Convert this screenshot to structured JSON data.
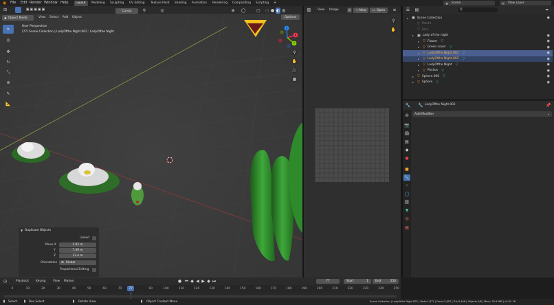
{
  "menu": {
    "items": [
      "File",
      "Edit",
      "Render",
      "Window",
      "Help"
    ],
    "workspaces": [
      "Layout",
      "Modeling",
      "Sculpting",
      "UV Editing",
      "Texture Paint",
      "Shading",
      "Animation",
      "Rendering",
      "Compositing",
      "Scripting"
    ],
    "active_workspace": "Layout",
    "add_tab": "+",
    "scene_label": "Scene",
    "view_layer_label": "View Layer"
  },
  "viewport": {
    "mode": "Object Mode",
    "menus": [
      "View",
      "Select",
      "Add",
      "Object"
    ],
    "transform_orientation": "Cursor",
    "options_label": "Options",
    "perspective": "User Perspective",
    "collection_info": "(77) Scene Collection | LadyOfthe Night.002 : LadyOfthe Night",
    "gizmo": {
      "x": "X",
      "y": "Y",
      "z": "Z"
    }
  },
  "operator_panel": {
    "title": "Duplicate Objects",
    "linked_label": "Linked",
    "move_x_label": "Move X",
    "move_x": "5.92 m",
    "y_label": "Y",
    "y": "7.49 m",
    "z_label": "Z",
    "z": "13.4 m",
    "orientation_label": "Orientation",
    "orientation": "Global",
    "proportional_label": "Proportional Editing"
  },
  "image_editor": {
    "menus": [
      "View",
      "Image"
    ],
    "new_label": "+ New",
    "open_label": "Open"
  },
  "outliner": {
    "search_placeholder": "",
    "items": [
      {
        "label": "Scene Collection",
        "indent": 0,
        "kind": "collection",
        "muted": false,
        "selected": false
      },
      {
        "label": "Point1",
        "indent": 1,
        "kind": "muted",
        "muted": true,
        "selected": false
      },
      {
        "label": "Fern",
        "indent": 1,
        "kind": "muted",
        "muted": true,
        "selected": false
      },
      {
        "label": "Lady of the night",
        "indent": 1,
        "kind": "collection",
        "muted": false,
        "selected": false
      },
      {
        "label": "Flower",
        "indent": 2,
        "kind": "object",
        "muted": false,
        "selected": false
      },
      {
        "label": "Green cover",
        "indent": 2,
        "kind": "object",
        "muted": false,
        "selected": false
      },
      {
        "label": "LadyOfthe Night.001",
        "indent": 2,
        "kind": "object",
        "muted": false,
        "selected": "active"
      },
      {
        "label": "LadyOfthe Night.002",
        "indent": 2,
        "kind": "object",
        "muted": false,
        "selected": "secondary"
      },
      {
        "label": "LadyOfthe Night",
        "indent": 2,
        "kind": "object",
        "muted": false,
        "selected": false
      },
      {
        "label": "Pistilos",
        "indent": 2,
        "kind": "object",
        "muted": false,
        "selected": false
      },
      {
        "label": "Sphere.006",
        "indent": 1,
        "kind": "object",
        "muted": false,
        "selected": false
      },
      {
        "label": "Sphere",
        "indent": 1,
        "kind": "object",
        "muted": false,
        "selected": false
      }
    ]
  },
  "properties": {
    "object_name": "LadyOfthe Night.002",
    "add_modifier": "Add Modifier"
  },
  "timeline": {
    "menus": [
      "Playback",
      "Keying",
      "View",
      "Marker"
    ],
    "current_frame": "77",
    "start_label": "Start",
    "start": "1",
    "end_label": "End",
    "end": "250",
    "ruler": [
      "0",
      "10",
      "20",
      "30",
      "40",
      "50",
      "60",
      "70",
      "77",
      "90",
      "100",
      "110",
      "120",
      "130",
      "140",
      "150",
      "160",
      "170",
      "180",
      "190",
      "200",
      "210",
      "220",
      "230",
      "240",
      "250"
    ]
  },
  "statusbar": {
    "select": "Select",
    "box_select": "Box Select",
    "rotate_view": "Rotate View",
    "context_menu": "Object Context Menu",
    "stats": "Scene Collection | LadyOfthe Night.002 | Verts:1,872 | Faces:2,607 | Tris:3,408 | Objects:1/8 | Mem: 76.9 MiB | v2.81.16"
  },
  "colors": {
    "accent_blue": "#4772b3",
    "selected_row": "#4a5f8f",
    "object_orange": "#f0a030",
    "mesh_teal": "#45c2a3",
    "x_axis": "#ff3352",
    "y_axis": "#8bdc00",
    "z_axis": "#2890ff"
  }
}
